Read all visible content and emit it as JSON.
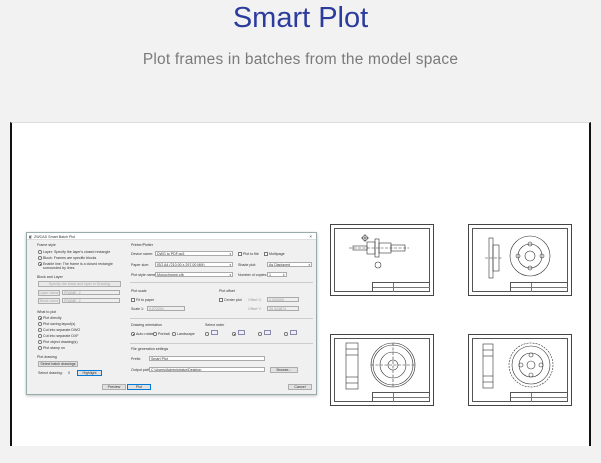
{
  "header": {
    "title": "Smart Plot",
    "subtitle": "Plot frames in batches from the model space"
  },
  "dialog": {
    "title": "ZWCAD Smart Batch Plot",
    "frame_style": {
      "heading": "Frame style",
      "options": [
        "Layer: Specify the layer's closed rectangle",
        "Block: Frames are specific blocks",
        "Enable line: The frame is a closed rectangle surrounded by lines"
      ],
      "selected_index": 2
    },
    "block_and_layer": {
      "heading": "Block and Layer",
      "pick_button": "Specify the block and layer in Drawing",
      "layer_button": "Layer name",
      "layer_value": "FRAME_2",
      "block_button": "Block name",
      "block_value": "FRAME_2"
    },
    "what_to_plot": {
      "heading": "What to plot",
      "options": [
        "Plot directly",
        "Plot saving layout(s)",
        "Cut into separate DWG",
        "Cut into separate DXF",
        "Plot object drawing(s)",
        "Plot stamp on"
      ],
      "selected_index": 0
    },
    "plot_drawing": {
      "heading": "Plot drawing",
      "select_button": "Select batch drawings",
      "select_label": "Select drawing:",
      "select_count": "0",
      "highlight_button": "Highlight"
    },
    "printer": {
      "heading": "Printer/Plotter",
      "device_label": "Device name:",
      "device_value": "DWG to PDF.pc5",
      "plot_to_file": "Plot to file",
      "multipage": "Multipage",
      "paper_label": "Paper size:",
      "paper_value": "ISO A4 (210.00 x 297.00 MM)",
      "shade_label": "Shade plot:",
      "shade_value": "As Displayed",
      "style_label": "Plot style name:",
      "style_value": "Monochrome.ctb",
      "copies_label": "Number of copies:",
      "copies_value": "1"
    },
    "plot_scale": {
      "heading": "Plot scale",
      "fit_label": "Fit to paper",
      "scale_label": "Scale 1:",
      "scale_value": "0.972251"
    },
    "plot_offset": {
      "heading": "Plot offset",
      "center_label": "Center plot",
      "offset_x_label": "Offset X:",
      "offset_x_value": "0.000000",
      "offset_y_label": "Offset Y:",
      "offset_y_value": "39.324874"
    },
    "orientation": {
      "heading": "Drawing orientation",
      "options": [
        "Auto rotate",
        "Portrait",
        "Landscape"
      ],
      "selected_index": 0
    },
    "order": {
      "heading": "Select order"
    },
    "file_gen": {
      "heading": "File generation settings",
      "prefix_label": "Prefix:",
      "prefix_value": "Smart Plot",
      "path_label": "Output path:",
      "path_value": "C:\\Users\\Administrator\\Desktop",
      "browse_button": "Browse..."
    },
    "buttons": {
      "preview": "Preview",
      "plot": "Plot",
      "cancel": "Cancel"
    }
  },
  "icons": {
    "close": "close-icon",
    "dropdown": "chevron-down-icon",
    "order": "order-icon"
  },
  "colors": {
    "title": "#2b3c9c",
    "subtitle": "#7a7a7a"
  }
}
